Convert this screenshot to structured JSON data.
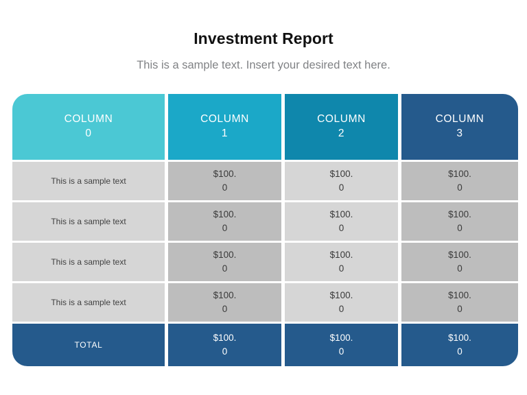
{
  "slide": {
    "title": "Investment Report",
    "subtitle": "This is a sample text. Insert your desired text here."
  },
  "theme": {
    "header_col0": "#4BC8D4",
    "header_col1": "#1BA8C8",
    "header_col2": "#0F87AC",
    "header_col3": "#255A8C",
    "cell_light": "#D6D6D6",
    "cell_dark": "#BDBDBD",
    "total_bg": "#255A8C",
    "title_color": "#111111",
    "subtitle_color": "#808285"
  },
  "table": {
    "headers": [
      {
        "label": "COLUMN",
        "index": "0"
      },
      {
        "label": "COLUMN",
        "index": "1"
      },
      {
        "label": "COLUMN",
        "index": "2"
      },
      {
        "label": "COLUMN",
        "index": "3"
      }
    ],
    "rows": [
      {
        "label": "This is a sample text",
        "values": [
          {
            "main": "$100.",
            "dec": "0"
          },
          {
            "main": "$100.",
            "dec": "0"
          },
          {
            "main": "$100.",
            "dec": "0"
          }
        ]
      },
      {
        "label": "This is a sample text",
        "values": [
          {
            "main": "$100.",
            "dec": "0"
          },
          {
            "main": "$100.",
            "dec": "0"
          },
          {
            "main": "$100.",
            "dec": "0"
          }
        ]
      },
      {
        "label": "This is a sample text",
        "values": [
          {
            "main": "$100.",
            "dec": "0"
          },
          {
            "main": "$100.",
            "dec": "0"
          },
          {
            "main": "$100.",
            "dec": "0"
          }
        ]
      },
      {
        "label": "This is a sample text",
        "values": [
          {
            "main": "$100.",
            "dec": "0"
          },
          {
            "main": "$100.",
            "dec": "0"
          },
          {
            "main": "$100.",
            "dec": "0"
          }
        ]
      }
    ],
    "total": {
      "label": "TOTAL",
      "values": [
        {
          "main": "$100.",
          "dec": "0"
        },
        {
          "main": "$100.",
          "dec": "0"
        },
        {
          "main": "$100.",
          "dec": "0"
        }
      ]
    }
  }
}
